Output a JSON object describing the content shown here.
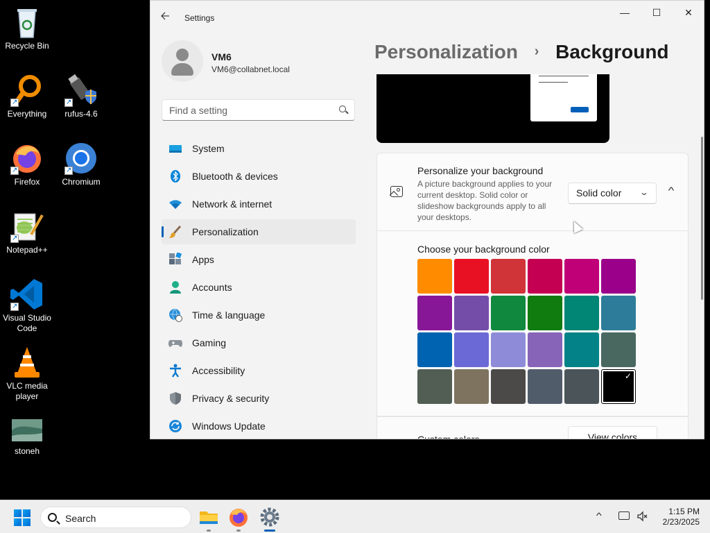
{
  "desktop": {
    "icons": [
      {
        "label": "Recycle Bin",
        "icon": "recycle-bin-icon"
      },
      {
        "label": "Everything",
        "icon": "everything-search-icon"
      },
      {
        "label": "rufus-4.6",
        "icon": "usb-drive-icon"
      },
      {
        "label": "Firefox",
        "icon": "firefox-icon"
      },
      {
        "label": "Chromium",
        "icon": "chromium-icon"
      },
      {
        "label": "Notepad++",
        "icon": "notepad-plus-plus-icon"
      },
      {
        "label": "Visual Studio Code",
        "icon": "vscode-icon"
      },
      {
        "label": "VLC media player",
        "icon": "vlc-cone-icon"
      },
      {
        "label": "stoneh",
        "icon": "image-thumbnail-icon"
      }
    ]
  },
  "window": {
    "title": "Settings",
    "controls": {
      "minimize": "—",
      "maximize": "☐",
      "close": "✕"
    }
  },
  "user": {
    "name": "VM6",
    "email": "VM6@collabnet.local"
  },
  "search": {
    "placeholder": "Find a setting"
  },
  "sidebar": {
    "items": [
      {
        "label": "System",
        "icon": "system-display-icon"
      },
      {
        "label": "Bluetooth & devices",
        "icon": "bluetooth-icon"
      },
      {
        "label": "Network & internet",
        "icon": "wifi-icon"
      },
      {
        "label": "Personalization",
        "icon": "paintbrush-icon",
        "active": true
      },
      {
        "label": "Apps",
        "icon": "apps-icon"
      },
      {
        "label": "Accounts",
        "icon": "account-icon"
      },
      {
        "label": "Time & language",
        "icon": "globe-clock-icon"
      },
      {
        "label": "Gaming",
        "icon": "gamepad-icon"
      },
      {
        "label": "Accessibility",
        "icon": "accessibility-icon"
      },
      {
        "label": "Privacy & security",
        "icon": "shield-icon"
      },
      {
        "label": "Windows Update",
        "icon": "update-icon"
      }
    ]
  },
  "breadcrumb": {
    "parent": "Personalization",
    "separator": "›",
    "current": "Background"
  },
  "background": {
    "title": "Personalize your background",
    "description": "A picture background applies to your current desktop. Solid color or slideshow backgrounds apply to all your desktops.",
    "selected": "Solid color",
    "colors_title": "Choose your background color",
    "colors": [
      "#ff8c00",
      "#e81123",
      "#d13438",
      "#c30052",
      "#bf0077",
      "#9a0089",
      "#881798",
      "#744da9",
      "#10893e",
      "#107c10",
      "#018574",
      "#2d7d9a",
      "#0063b1",
      "#6b69d6",
      "#8e8cd8",
      "#8764b8",
      "#038387",
      "#486860",
      "#525e54",
      "#7e735f",
      "#4c4a48",
      "#515c6b",
      "#4a5459",
      "#000000"
    ],
    "selected_color_index": 23,
    "custom_label": "Custom colors",
    "view_colors": "View colors"
  },
  "taskbar": {
    "search": "Search",
    "apps": [
      "file-explorer-icon",
      "firefox-icon",
      "settings-gear-icon"
    ],
    "time": "1:15 PM",
    "date": "2/23/2025"
  }
}
